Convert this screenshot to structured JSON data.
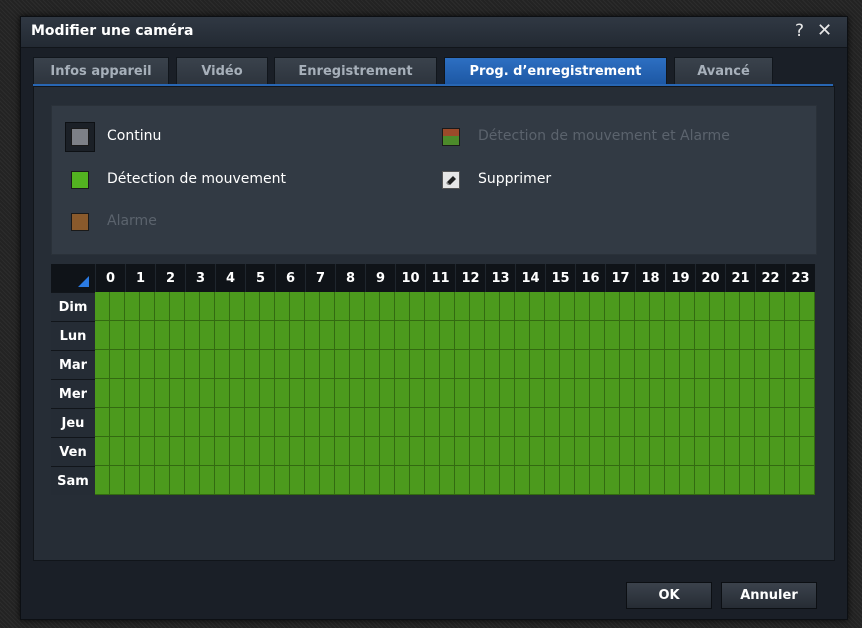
{
  "dialog": {
    "title": "Modifier une caméra",
    "help_label": "?",
    "close_label": "✕"
  },
  "tabs": [
    {
      "label": "Infos appareil",
      "active": false
    },
    {
      "label": "Vidéo",
      "active": false
    },
    {
      "label": "Enregistrement",
      "active": false
    },
    {
      "label": "Prog. d’enregistrement",
      "active": true
    },
    {
      "label": "Avancé",
      "active": false
    }
  ],
  "legend": {
    "continuous": {
      "label": "Continu",
      "color": "#7d8087",
      "selected": true
    },
    "motion": {
      "label": "Détection de mouvement",
      "color": "#53b320"
    },
    "alarm": {
      "label": "Alarme",
      "color": "#8a5a2c",
      "disabled": true
    },
    "motion_alarm": {
      "label": "Détection de mouvement et Alarme",
      "color": "#5a7a3a",
      "disabled": true
    },
    "delete": {
      "label": "Supprimer",
      "icon": "eraser-icon"
    }
  },
  "schedule": {
    "hours": [
      "0",
      "1",
      "2",
      "3",
      "4",
      "5",
      "6",
      "7",
      "8",
      "9",
      "10",
      "11",
      "12",
      "13",
      "14",
      "15",
      "16",
      "17",
      "18",
      "19",
      "20",
      "21",
      "22",
      "23"
    ],
    "days": [
      "Dim",
      "Lun",
      "Mar",
      "Mer",
      "Jeu",
      "Ven",
      "Sam"
    ],
    "cell_color": "#4c9a1d",
    "cell_mode": "motion"
  },
  "footer": {
    "ok_label": "OK",
    "cancel_label": "Annuler"
  }
}
